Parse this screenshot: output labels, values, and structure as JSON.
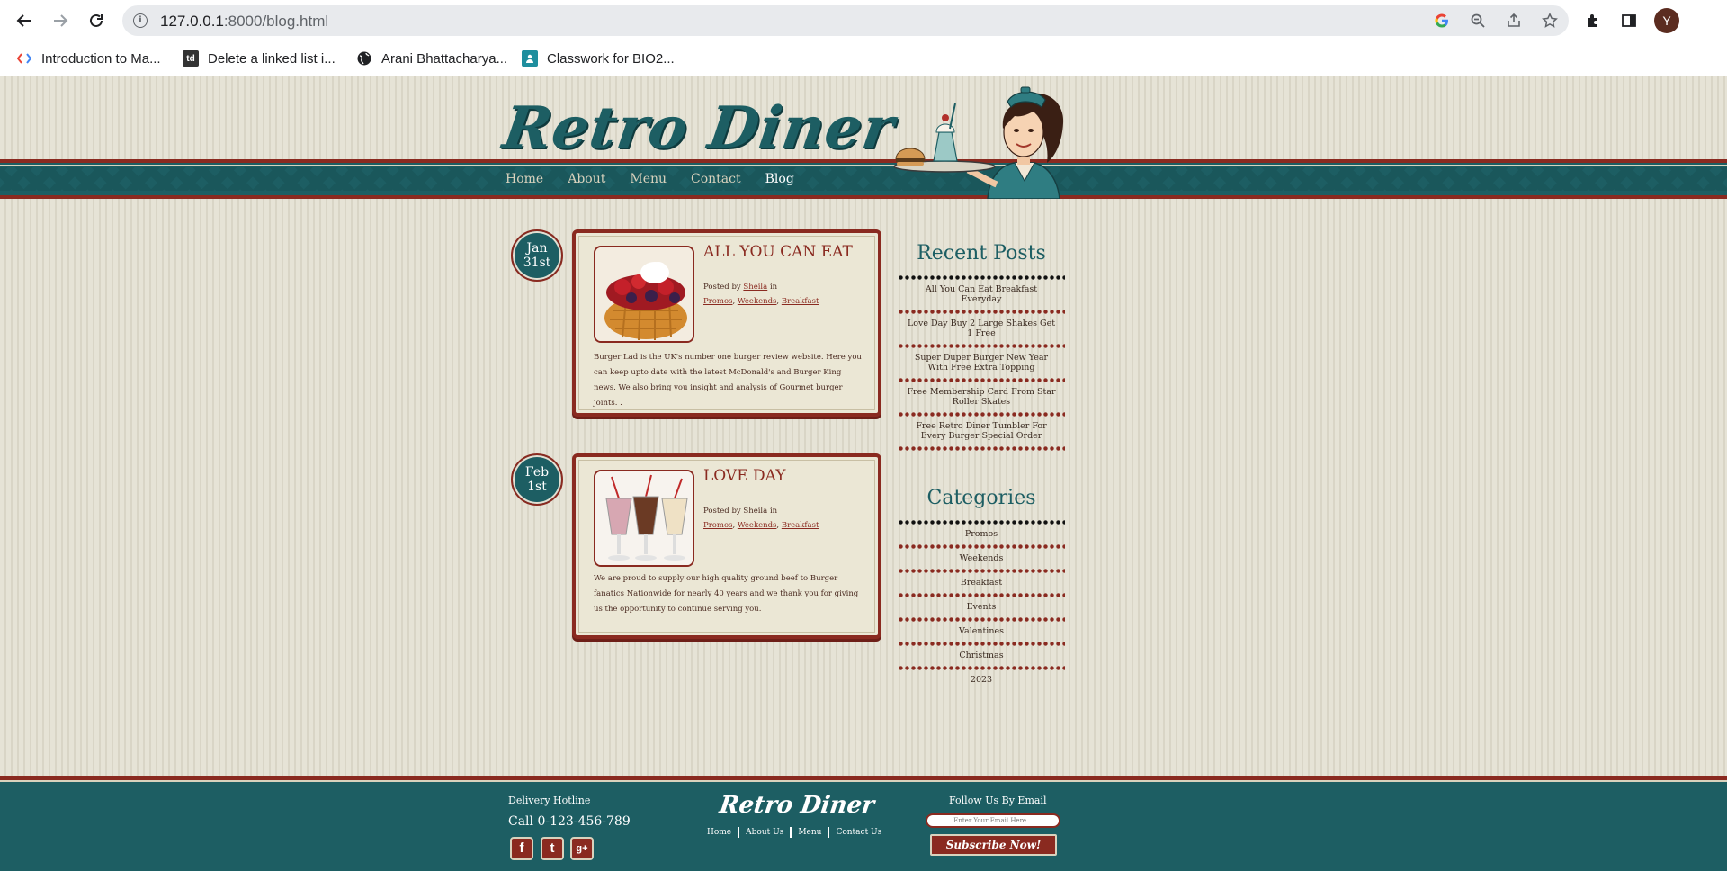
{
  "browser": {
    "url_host": "127.0.0.1",
    "url_rest": ":8000/blog.html",
    "avatar_letter": "Y",
    "bookmarks": [
      {
        "icon": "code-icon",
        "label": "Introduction to Ma..."
      },
      {
        "icon": "td-icon",
        "label": "Delete a linked list i..."
      },
      {
        "icon": "globe-icon",
        "label": "Arani Bhattacharya..."
      },
      {
        "icon": "classroom-icon",
        "label": "Classwork for BIO2..."
      }
    ]
  },
  "site": {
    "logo": "Retro Diner",
    "nav": [
      "Home",
      "About",
      "Menu",
      "Contact",
      "Blog"
    ],
    "active_nav": "Blog"
  },
  "posts": [
    {
      "date_month": "Jan",
      "date_day": "31st",
      "title": "ALL YOU CAN EAT",
      "posted_by": "Posted by",
      "author": "Sheila",
      "in": "in",
      "categories": [
        "Promos",
        "Weekends",
        "Breakfast"
      ],
      "image": "waffle-image",
      "body": "Burger Lad is the UK's number one burger review website. Here you can keep upto date with the latest McDonald's and Burger King news. We also bring you insight and analysis of Gourmet burger joints. ."
    },
    {
      "date_month": "Feb",
      "date_day": "1st",
      "title": "LOVE DAY",
      "posted_by": "Posted by",
      "author": "Sheila",
      "in": "in",
      "categories": [
        "Promos",
        "Weekends",
        "Breakfast"
      ],
      "image": "milkshakes-image",
      "body": "We are proud to supply our high quality ground beef to Burger fanatics Nationwide for nearly 40 years and we thank you for giving us the opportunity to continue serving you."
    }
  ],
  "sidebar": {
    "recent_heading": "Recent Posts",
    "recent": [
      "All You Can Eat Breakfast Everyday",
      "Love Day Buy 2 Large Shakes Get 1 Free",
      "Super Duper Burger New Year With Free Extra Topping",
      "Free Membership Card From Star Roller Skates",
      "Free Retro Diner Tumbler For Every Burger Special Order"
    ],
    "categories_heading": "Categories",
    "categories": [
      "Promos",
      "Weekends",
      "Breakfast",
      "Events",
      "Valentines",
      "Christmas",
      "2023"
    ]
  },
  "footer": {
    "hotline_label": "Delivery Hotline",
    "hotline_number": "Call 0-123-456-789",
    "logo": "Retro Diner",
    "nav": [
      "Home",
      "About Us",
      "Menu",
      "Contact Us"
    ],
    "follow_label": "Follow Us By Email",
    "email_placeholder": "Enter Your Email Here...",
    "subscribe_label": "Subscribe Now!",
    "social": [
      "f",
      "t",
      "g+"
    ]
  },
  "colors": {
    "teal": "#1d5e63",
    "maroon": "#8a2a20",
    "cream": "#ebe7d5"
  }
}
